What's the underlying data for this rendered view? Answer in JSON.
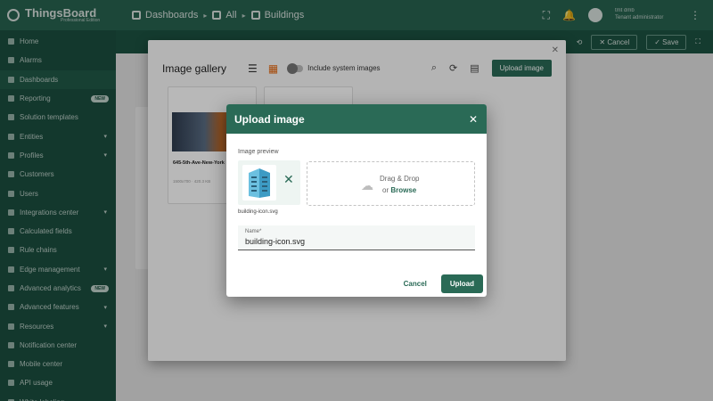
{
  "app": {
    "brand": "ThingsBoard",
    "brand_sub": "Professional Edition",
    "breadcrumbs": [
      "Dashboards",
      "All",
      "Buildings"
    ],
    "user_name": "tmt dmb",
    "user_role": "Tenant administrator"
  },
  "sidebar": {
    "items": [
      {
        "label": "Home"
      },
      {
        "label": "Alarms"
      },
      {
        "label": "Dashboards"
      },
      {
        "label": "Reporting",
        "badge": "NEW"
      },
      {
        "label": "Solution templates"
      },
      {
        "label": "Entities",
        "expandable": true
      },
      {
        "label": "Profiles",
        "expandable": true
      },
      {
        "label": "Customers"
      },
      {
        "label": "Users"
      },
      {
        "label": "Integrations center",
        "expandable": true
      },
      {
        "label": "Calculated fields"
      },
      {
        "label": "Rule chains"
      },
      {
        "label": "Edge management",
        "expandable": true
      },
      {
        "label": "Advanced analytics",
        "badge": "NEW"
      },
      {
        "label": "Advanced features",
        "expandable": true
      },
      {
        "label": "Resources",
        "expandable": true
      },
      {
        "label": "Notification center"
      },
      {
        "label": "Mobile center"
      },
      {
        "label": "API usage"
      },
      {
        "label": "White labeling"
      }
    ]
  },
  "toolbar": {
    "cancel_label": "Cancel",
    "save_label": "Save"
  },
  "gallery": {
    "title": "Image gallery",
    "include_system_label": "Include system images",
    "upload_button": "Upload image",
    "card_name": "645-5th-Ave-New-York",
    "card_meta": "1500x700 · 420.3 KB"
  },
  "upload_dialog": {
    "title": "Upload image",
    "preview_label": "Image preview",
    "file_name": "building-icon.svg",
    "drop_text": "Drag & Drop",
    "or_text": "or",
    "browse_text": "Browse",
    "name_label": "Name*",
    "name_value": "building-icon.svg",
    "cancel_label": "Cancel",
    "upload_label": "Upload"
  }
}
